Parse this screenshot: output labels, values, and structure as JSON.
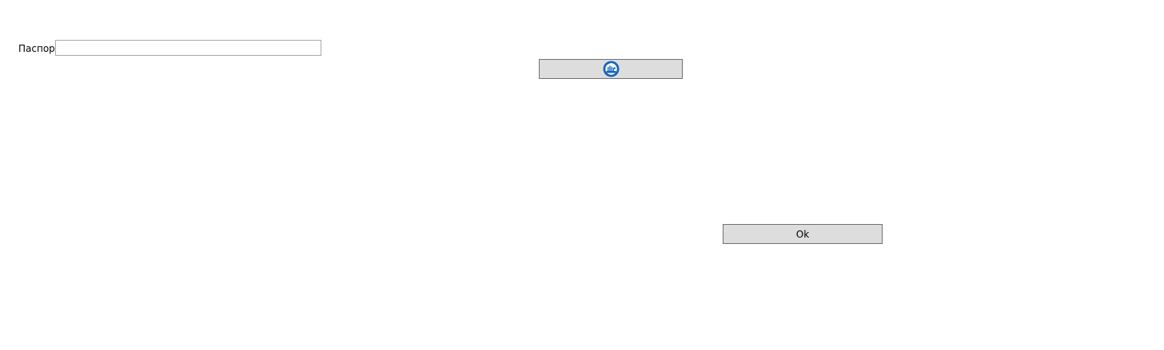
{
  "form": {
    "passport_label": "Паспорт",
    "passport_value": "",
    "passport_placeholder": ""
  },
  "scan_button": {
    "icon": "document-scanner-icon",
    "accent_color": "#1565c0"
  },
  "ok_button": {
    "label": "Ok"
  }
}
